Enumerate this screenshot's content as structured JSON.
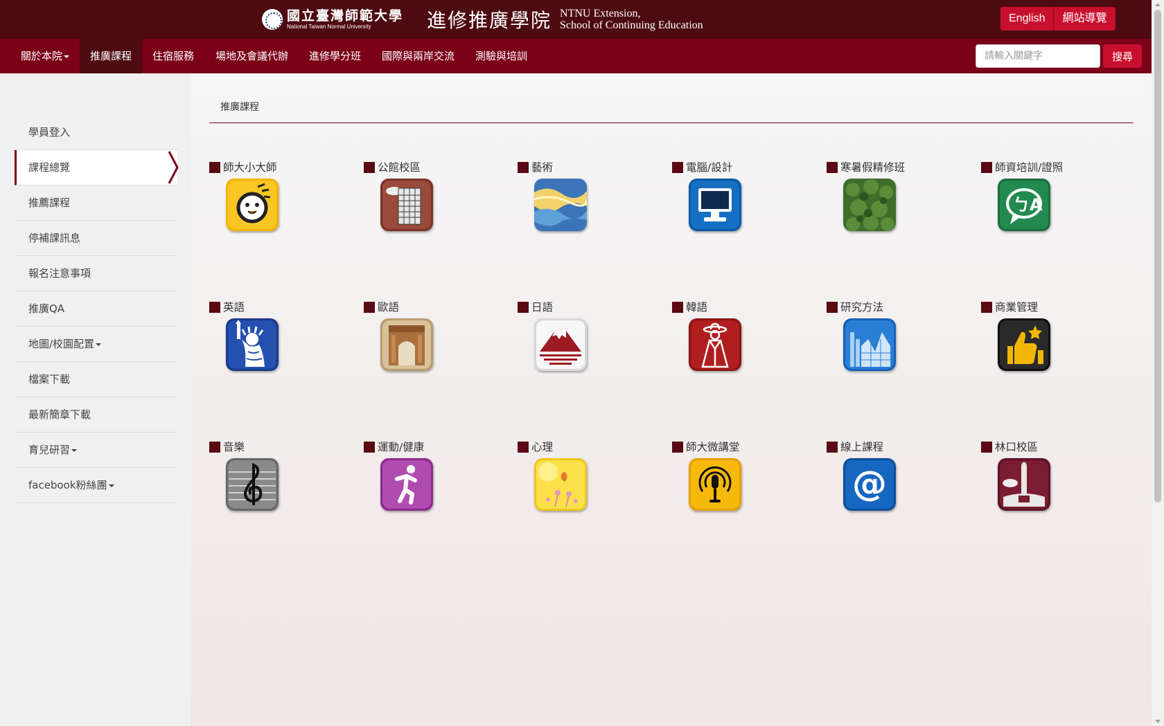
{
  "header": {
    "university_zh": "國立臺灣師範大學",
    "university_en": "National Taiwan Normal University",
    "school_zh": "進修推廣學院",
    "school_en_line1": "NTNU Extension,",
    "school_en_line2": "School of Continuing Education",
    "english_link": "English",
    "sitemap_link": "網站導覽"
  },
  "nav": {
    "items": [
      {
        "label": "關於本院",
        "dropdown": true
      },
      {
        "label": "推廣課程",
        "active": true
      },
      {
        "label": "住宿服務"
      },
      {
        "label": "場地及會議代辦"
      },
      {
        "label": "進修學分班"
      },
      {
        "label": "國際與兩岸交流"
      },
      {
        "label": "測驗與培訓"
      }
    ],
    "search_placeholder": "請輸入關鍵字",
    "search_button": "搜尋"
  },
  "sidebar": {
    "items": [
      {
        "label": "學員登入"
      },
      {
        "label": "課程總覽",
        "active": true
      },
      {
        "label": "推薦課程"
      },
      {
        "label": "停補課訊息"
      },
      {
        "label": "報名注意事項"
      },
      {
        "label": "推廣QA"
      },
      {
        "label": "地圖/校園配置",
        "dropdown": true
      },
      {
        "label": "檔案下載"
      },
      {
        "label": "最新簡章下載"
      },
      {
        "label": "育兒研習",
        "dropdown": true
      },
      {
        "label": "facebook粉絲團",
        "dropdown": true
      }
    ]
  },
  "main": {
    "breadcrumb": "推廣課程",
    "categories": [
      {
        "label": "師大小大師",
        "icon": "chick-face-icon"
      },
      {
        "label": "公館校區",
        "icon": "campus-building-icon"
      },
      {
        "label": "藝術",
        "icon": "painting-icon"
      },
      {
        "label": "電腦/設計",
        "icon": "computer-monitor-icon"
      },
      {
        "label": "寒暑假精修班",
        "icon": "leaves-icon"
      },
      {
        "label": "師資培訓/證照",
        "icon": "phonetic-a-icon"
      },
      {
        "label": "英語",
        "icon": "statue-of-liberty-icon"
      },
      {
        "label": "歐語",
        "icon": "arc-de-triomphe-icon"
      },
      {
        "label": "日語",
        "icon": "mount-fuji-icon"
      },
      {
        "label": "韓語",
        "icon": "hanbok-figure-icon"
      },
      {
        "label": "研究方法",
        "icon": "bar-chart-icon"
      },
      {
        "label": "商業管理",
        "icon": "thumbs-up-star-icon"
      },
      {
        "label": "音樂",
        "icon": "treble-clef-icon"
      },
      {
        "label": "運動/健康",
        "icon": "running-person-icon"
      },
      {
        "label": "心理",
        "icon": "flower-icon"
      },
      {
        "label": "師大微講堂",
        "icon": "podcast-microphone-icon"
      },
      {
        "label": "線上課程",
        "icon": "at-sign-icon"
      },
      {
        "label": "林口校區",
        "icon": "linkou-campus-icon"
      }
    ]
  },
  "colors": {
    "header_bg": "#4d0a11",
    "nav_bg": "#7b0018",
    "accent_red": "#c8102e",
    "bullet": "#5a0a12"
  }
}
